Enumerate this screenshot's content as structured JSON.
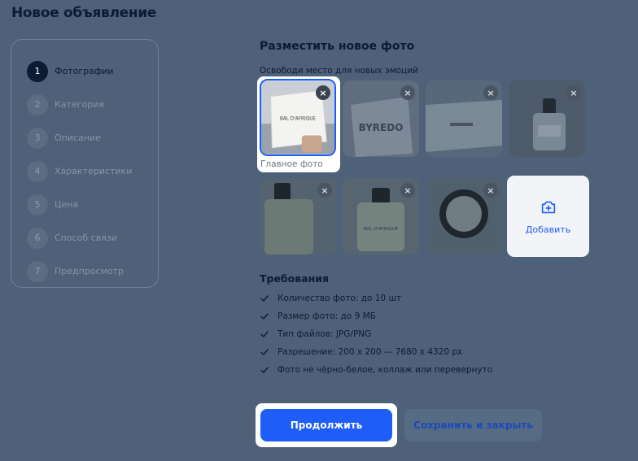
{
  "page": {
    "title": "Новое объявление"
  },
  "steps": [
    {
      "number": "1",
      "label": "Фотографии"
    },
    {
      "number": "2",
      "label": "Категория"
    },
    {
      "number": "3",
      "label": "Описание"
    },
    {
      "number": "4",
      "label": "Характеристики"
    },
    {
      "number": "5",
      "label": "Цена"
    },
    {
      "number": "6",
      "label": "Способ связи"
    },
    {
      "number": "7",
      "label": "Предпросмотр"
    }
  ],
  "photos": {
    "title": "Разместить новое фото",
    "subtitle": "Освободи место для новых эмоций",
    "main_caption": "Главное фото",
    "remove_glyph": "×",
    "add_label": "Добавить",
    "items": [
      {
        "text": "BAL D'AFRIQUE"
      },
      {
        "text": "BYREDO"
      },
      {
        "text": ""
      },
      {
        "text": ""
      },
      {
        "text": ""
      },
      {
        "text": "BAL D'AFRIQUE"
      },
      {
        "text": ""
      }
    ]
  },
  "requirements": {
    "title": "Требования",
    "items": [
      "Количество фото: до 10 шт",
      "Размер фото: до 9 МБ",
      "Тип файлов: JPG/PNG",
      "Разрешение: 200 x 200 — 7680 x 4320 px",
      "Фото не чёрно-белое, коллаж или перевернуто"
    ]
  },
  "actions": {
    "continue_label": "Продолжить",
    "save_close_label": "Сохранить и закрыть"
  },
  "colors": {
    "accent": "#1e5ef6",
    "overlay": "#4e6178",
    "text_dark": "#0c1b33"
  }
}
